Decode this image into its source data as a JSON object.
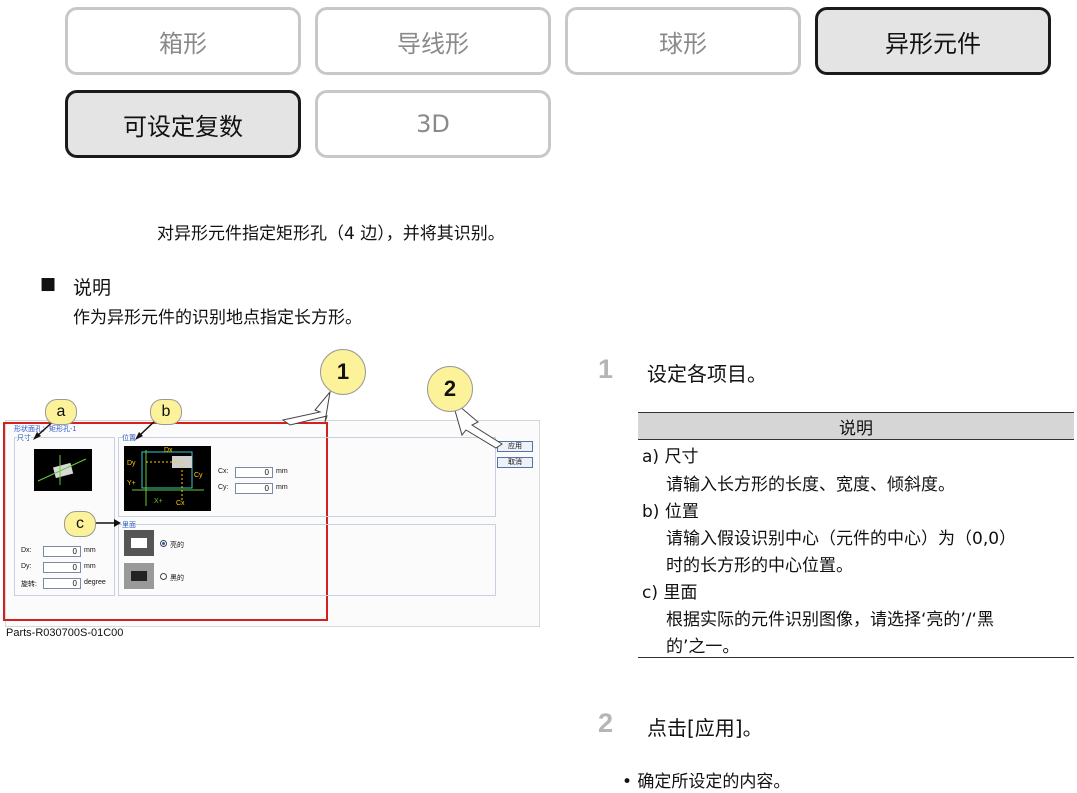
{
  "tabs": {
    "box": "箱形",
    "lead": "导线形",
    "ball": "球形",
    "odd": "异形元件",
    "multi": "可设定复数",
    "td": "3D"
  },
  "intro": "对异形元件指定矩形孔（4 边），并将其识别。",
  "section": {
    "marker": "■",
    "heading": "说明",
    "body": "作为异形元件的识别地点指定长方形。"
  },
  "screenshot": {
    "caption": "Parts-R030700S-01C00",
    "callouts": {
      "one": "1",
      "two": "2",
      "a": "a",
      "b": "b",
      "c": "c"
    },
    "title": "形状面孔：矩形孔-1",
    "size_group": "尺寸",
    "pos_group": "位置",
    "back_group": "里面",
    "dx_label": "Dx:",
    "dx_value": "0",
    "dx_unit": "mm",
    "dy_label": "Dy:",
    "dy_value": "0",
    "dy_unit": "mm",
    "rot_label": "旋转:",
    "rot_value": "0",
    "rot_unit": "degree",
    "cx_label": "Cx:",
    "cx_value": "0",
    "cx_unit": "mm",
    "cy_label": "Cy:",
    "cy_value": "0",
    "cy_unit": "mm",
    "bright_label": "亮的",
    "dark_label": "黑的",
    "apply_btn": "应用",
    "cancel_btn": "取消",
    "img_dy": "Dy",
    "img_dx": "Dx",
    "img_cy": "Cy",
    "img_cx": "Cx",
    "img_y": "Y+",
    "img_x": "X+"
  },
  "steps": {
    "s1_num": "1",
    "s1_text": "设定各项目。",
    "table_header": "说明",
    "a_label": "a) 尺寸",
    "a_desc": "请输入长方形的长度、宽度、倾斜度。",
    "b_label": "b) 位置",
    "b_desc1": "请输入假设识别中心（元件的中心）为（0,0）",
    "b_desc2": "时的长方形的中心位置。",
    "c_label": "c) 里面",
    "c_desc1": "根据实际的元件识别图像，请选择‘亮的’/‘黑",
    "c_desc2": "的’之一。",
    "s2_num": "2",
    "s2_text": "点击[应用]。",
    "bullet": "• 确定所设定的内容。"
  },
  "colors": {
    "selected_tab_bg": "#e4e4e4",
    "callout_fill": "#fbf29a",
    "red_frame": "#d62020",
    "link_blue": "#2a56c6"
  }
}
